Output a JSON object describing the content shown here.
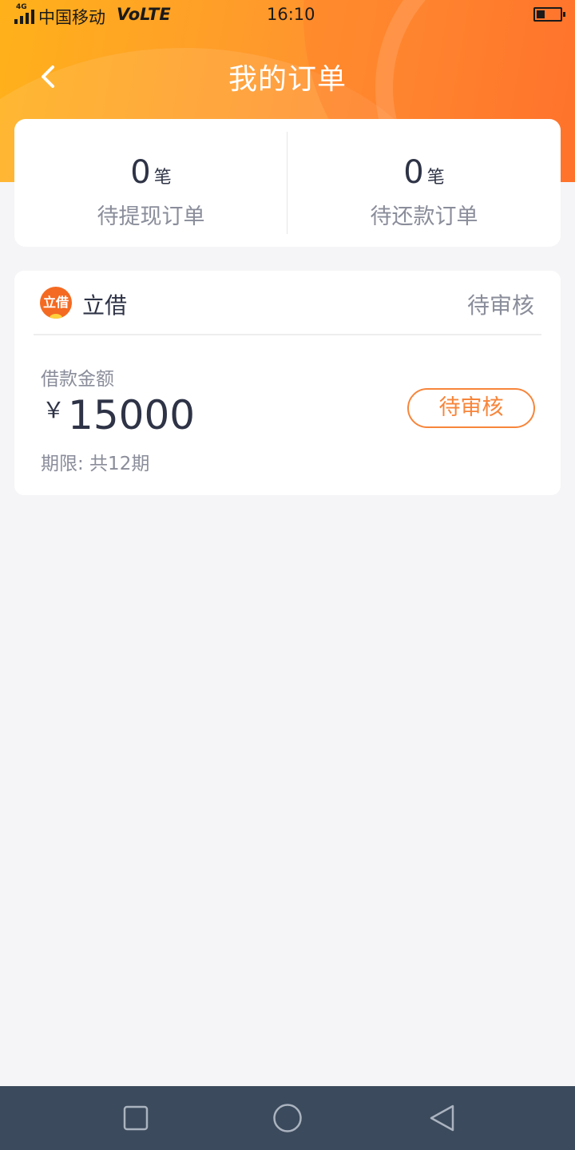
{
  "status_bar": {
    "network_type": "4G",
    "carrier": "中国移动",
    "volte": "VoLTE",
    "time": "16:10",
    "battery_level": 0.25,
    "signal_bars": 4
  },
  "header": {
    "title": "我的订单",
    "back_icon": "chevron-left-icon"
  },
  "summary": {
    "pending_withdraw": {
      "count": "0",
      "unit": "笔",
      "label": "待提现订单"
    },
    "pending_repay": {
      "count": "0",
      "unit": "笔",
      "label": "待还款订单"
    }
  },
  "order": {
    "logo_text": "立借",
    "lender": "立借",
    "status": "待审核",
    "amount_label": "借款金额",
    "currency": "￥",
    "amount": "15000",
    "term": "期限: 共12期",
    "status_button": "待审核"
  },
  "nav_bar": {
    "recent_icon": "square-icon",
    "home_icon": "circle-icon",
    "back_icon": "triangle-back-icon"
  },
  "colors": {
    "accent": "#f7853a",
    "header_gradient_start": "#ffb11a",
    "header_gradient_end": "#ff6f2c",
    "text_primary": "#2e3346",
    "text_secondary": "#8a8d9a",
    "nav_bar": "#3b4a5c"
  }
}
